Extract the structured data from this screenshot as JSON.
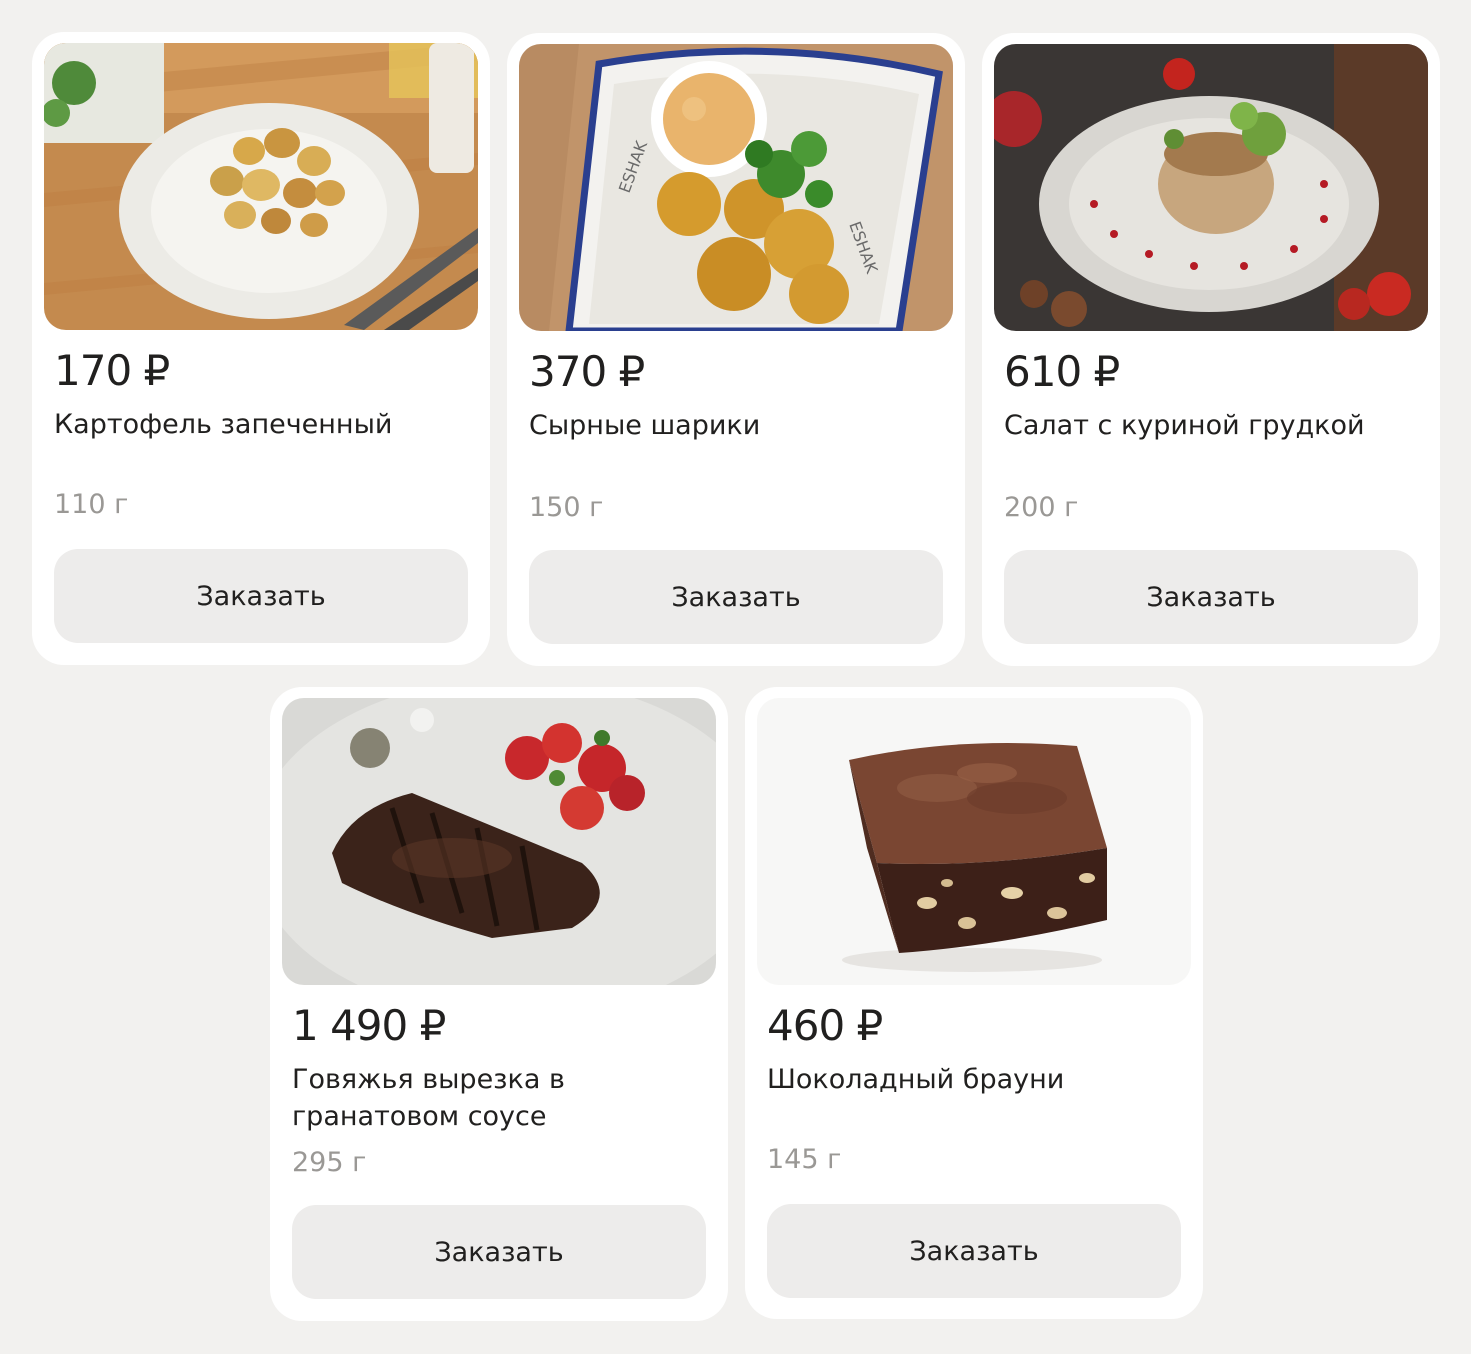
{
  "products": [
    {
      "price": "170 ₽",
      "name": "Картофель запеченный",
      "weight": "110 г",
      "button": "Заказать",
      "image": "baked-potatoes-photo"
    },
    {
      "price": "370 ₽",
      "name": "Сырные шарики",
      "weight": "150 г",
      "button": "Заказать",
      "image": "cheese-balls-photo"
    },
    {
      "price": "610 ₽",
      "name": "Салат с куриной грудкой",
      "weight": "200 г",
      "button": "Заказать",
      "image": "chicken-salad-photo"
    },
    {
      "price": "1 490 ₽",
      "name": "Говяжья вырезка в гранатовом соусе",
      "weight": "295 г",
      "button": "Заказать",
      "image": "beef-tenderloin-photo"
    },
    {
      "price": "460 ₽",
      "name": "Шоколадный брауни",
      "weight": "145 г",
      "button": "Заказать",
      "image": "chocolate-brownie-photo"
    }
  ]
}
